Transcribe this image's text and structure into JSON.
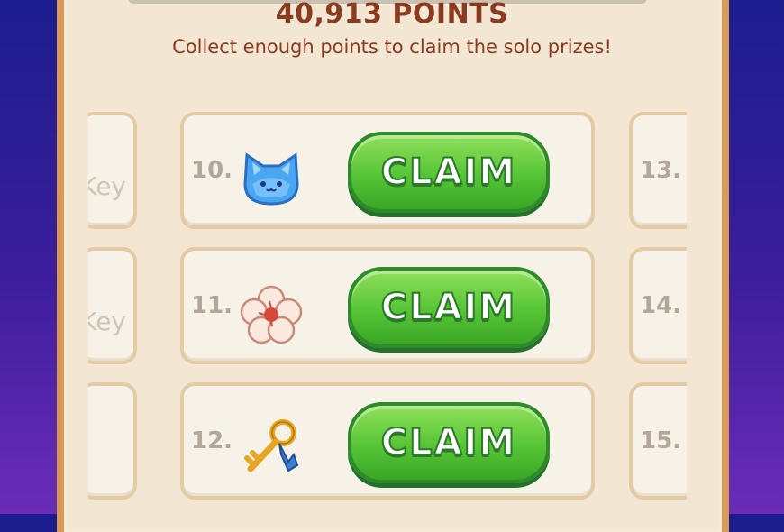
{
  "header": {
    "points": "40,913 POINTS",
    "subtitle": "Collect enough points to claim the solo prizes!"
  },
  "prizes": [
    {
      "number": "10.",
      "icon": "crystal-cat-icon",
      "button": "CLAIM"
    },
    {
      "number": "11.",
      "icon": "cotton-flower-icon",
      "button": "CLAIM"
    },
    {
      "number": "12.",
      "icon": "golden-key-icon",
      "button": "CLAIM"
    }
  ],
  "left_column": [
    {
      "text": "Key"
    },
    {
      "text": "Key"
    },
    {
      "text": ""
    }
  ],
  "right_column": [
    {
      "number": "13."
    },
    {
      "number": "14."
    },
    {
      "number": "15."
    }
  ],
  "colors": {
    "claim_green": "#56c436",
    "title_brown": "#8a3b20",
    "panel_cream": "#f3e6d3"
  }
}
